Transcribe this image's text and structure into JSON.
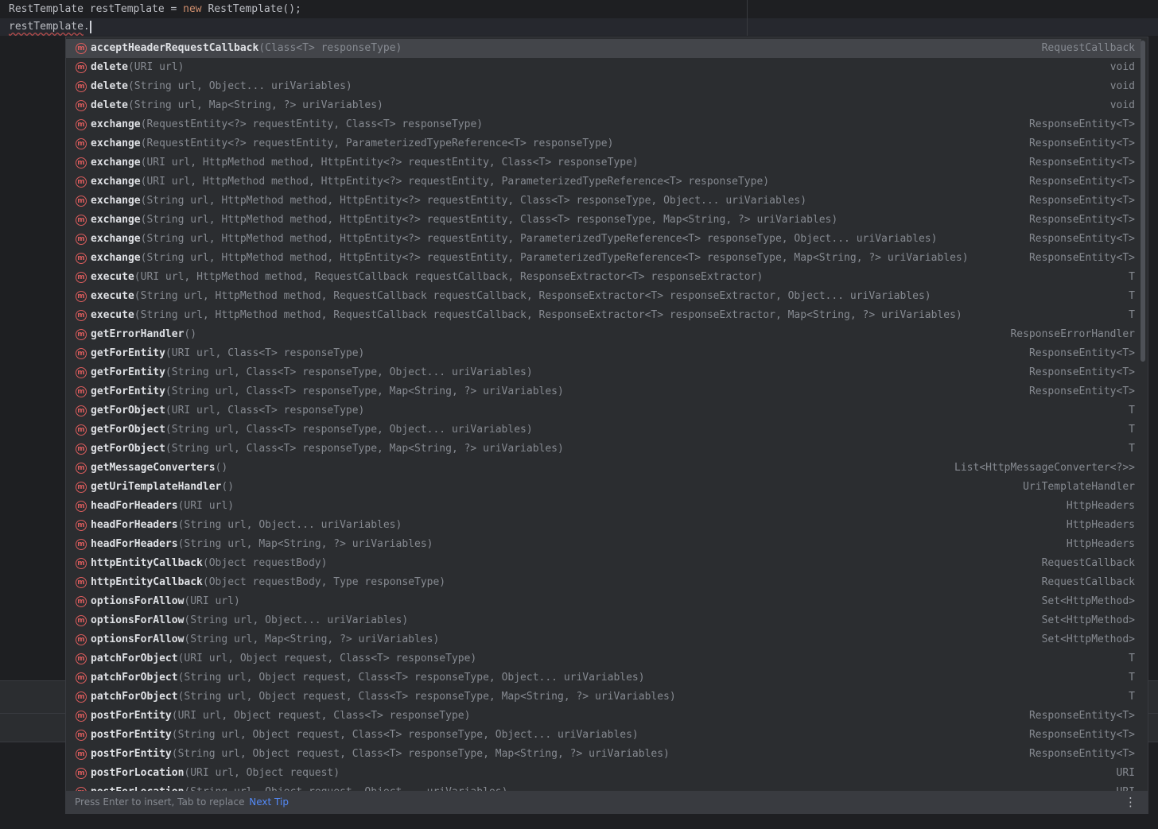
{
  "editor": {
    "line1": {
      "type": "RestTemplate",
      "var": " restTemplate = ",
      "kw": "new",
      "rest": " RestTemplate();"
    },
    "line2": {
      "text": "restTemplate",
      "dot": "."
    }
  },
  "completion": {
    "items": [
      {
        "name": "acceptHeaderRequestCallback",
        "sig": "(Class<T> responseType)",
        "ret": "RequestCallback",
        "selected": true
      },
      {
        "name": "delete",
        "sig": "(URI url)",
        "ret": "void"
      },
      {
        "name": "delete",
        "sig": "(String url, Object... uriVariables)",
        "ret": "void"
      },
      {
        "name": "delete",
        "sig": "(String url, Map<String, ?> uriVariables)",
        "ret": "void"
      },
      {
        "name": "exchange",
        "sig": "(RequestEntity<?> requestEntity, Class<T> responseType)",
        "ret": "ResponseEntity<T>"
      },
      {
        "name": "exchange",
        "sig": "(RequestEntity<?> requestEntity, ParameterizedTypeReference<T> responseType)",
        "ret": "ResponseEntity<T>"
      },
      {
        "name": "exchange",
        "sig": "(URI url, HttpMethod method, HttpEntity<?> requestEntity, Class<T> responseType)",
        "ret": "ResponseEntity<T>"
      },
      {
        "name": "exchange",
        "sig": "(URI url, HttpMethod method, HttpEntity<?> requestEntity, ParameterizedTypeReference<T> responseType)",
        "ret": "ResponseEntity<T>"
      },
      {
        "name": "exchange",
        "sig": "(String url, HttpMethod method, HttpEntity<?> requestEntity, Class<T> responseType, Object... uriVariables)",
        "ret": "ResponseEntity<T>"
      },
      {
        "name": "exchange",
        "sig": "(String url, HttpMethod method, HttpEntity<?> requestEntity, Class<T> responseType, Map<String, ?> uriVariables)",
        "ret": "ResponseEntity<T>"
      },
      {
        "name": "exchange",
        "sig": "(String url, HttpMethod method, HttpEntity<?> requestEntity, ParameterizedTypeReference<T> responseType, Object... uriVariables)",
        "ret": "ResponseEntity<T>"
      },
      {
        "name": "exchange",
        "sig": "(String url, HttpMethod method, HttpEntity<?> requestEntity, ParameterizedTypeReference<T> responseType, Map<String, ?> uriVariables)",
        "ret": "ResponseEntity<T>"
      },
      {
        "name": "execute",
        "sig": "(URI url, HttpMethod method, RequestCallback requestCallback, ResponseExtractor<T> responseExtractor)",
        "ret": "T"
      },
      {
        "name": "execute",
        "sig": "(String url, HttpMethod method, RequestCallback requestCallback, ResponseExtractor<T> responseExtractor, Object... uriVariables)",
        "ret": "T"
      },
      {
        "name": "execute",
        "sig": "(String url, HttpMethod method, RequestCallback requestCallback, ResponseExtractor<T> responseExtractor, Map<String, ?> uriVariables)",
        "ret": "T"
      },
      {
        "name": "getErrorHandler",
        "sig": "()",
        "ret": "ResponseErrorHandler"
      },
      {
        "name": "getForEntity",
        "sig": "(URI url, Class<T> responseType)",
        "ret": "ResponseEntity<T>"
      },
      {
        "name": "getForEntity",
        "sig": "(String url, Class<T> responseType, Object... uriVariables)",
        "ret": "ResponseEntity<T>"
      },
      {
        "name": "getForEntity",
        "sig": "(String url, Class<T> responseType, Map<String, ?> uriVariables)",
        "ret": "ResponseEntity<T>"
      },
      {
        "name": "getForObject",
        "sig": "(URI url, Class<T> responseType)",
        "ret": "T"
      },
      {
        "name": "getForObject",
        "sig": "(String url, Class<T> responseType, Object... uriVariables)",
        "ret": "T"
      },
      {
        "name": "getForObject",
        "sig": "(String url, Class<T> responseType, Map<String, ?> uriVariables)",
        "ret": "T"
      },
      {
        "name": "getMessageConverters",
        "sig": "()",
        "ret": "List<HttpMessageConverter<?>>"
      },
      {
        "name": "getUriTemplateHandler",
        "sig": "()",
        "ret": "UriTemplateHandler"
      },
      {
        "name": "headForHeaders",
        "sig": "(URI url)",
        "ret": "HttpHeaders"
      },
      {
        "name": "headForHeaders",
        "sig": "(String url, Object... uriVariables)",
        "ret": "HttpHeaders"
      },
      {
        "name": "headForHeaders",
        "sig": "(String url, Map<String, ?> uriVariables)",
        "ret": "HttpHeaders"
      },
      {
        "name": "httpEntityCallback",
        "sig": "(Object requestBody)",
        "ret": "RequestCallback"
      },
      {
        "name": "httpEntityCallback",
        "sig": "(Object requestBody, Type responseType)",
        "ret": "RequestCallback"
      },
      {
        "name": "optionsForAllow",
        "sig": "(URI url)",
        "ret": "Set<HttpMethod>"
      },
      {
        "name": "optionsForAllow",
        "sig": "(String url, Object... uriVariables)",
        "ret": "Set<HttpMethod>"
      },
      {
        "name": "optionsForAllow",
        "sig": "(String url, Map<String, ?> uriVariables)",
        "ret": "Set<HttpMethod>"
      },
      {
        "name": "patchForObject",
        "sig": "(URI url, Object request, Class<T> responseType)",
        "ret": "T"
      },
      {
        "name": "patchForObject",
        "sig": "(String url, Object request, Class<T> responseType, Object... uriVariables)",
        "ret": "T"
      },
      {
        "name": "patchForObject",
        "sig": "(String url, Object request, Class<T> responseType, Map<String, ?> uriVariables)",
        "ret": "T"
      },
      {
        "name": "postForEntity",
        "sig": "(URI url, Object request, Class<T> responseType)",
        "ret": "ResponseEntity<T>"
      },
      {
        "name": "postForEntity",
        "sig": "(String url, Object request, Class<T> responseType, Object... uriVariables)",
        "ret": "ResponseEntity<T>"
      },
      {
        "name": "postForEntity",
        "sig": "(String url, Object request, Class<T> responseType, Map<String, ?> uriVariables)",
        "ret": "ResponseEntity<T>"
      },
      {
        "name": "postForLocation",
        "sig": "(URI url, Object request)",
        "ret": "URI"
      },
      {
        "name": "postForLocation",
        "sig": "(String url, Object request, Object... uriVariables)",
        "ret": "URI"
      }
    ],
    "item_icon": "method-icon",
    "icon_letter": "m",
    "footer": {
      "hint": "Press Enter to insert, Tab to replace",
      "next_tip": "Next Tip",
      "more": "⋮"
    }
  },
  "colors": {
    "accent_link": "#548af7",
    "method_icon": "#db5c5c",
    "keyword": "#cf8e6d"
  }
}
